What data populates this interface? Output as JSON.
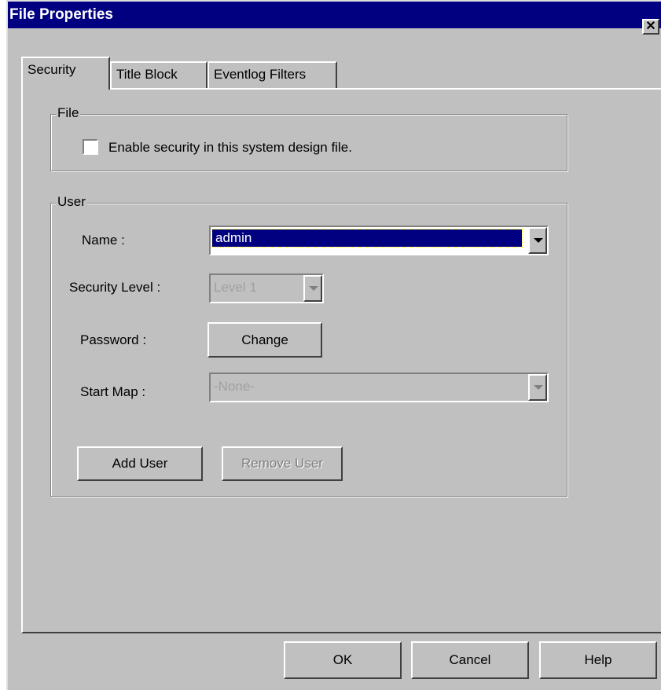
{
  "window": {
    "title": "File Properties",
    "close_glyph": "✕"
  },
  "tabs": [
    {
      "label": "Security",
      "active": true
    },
    {
      "label": "Title Block",
      "active": false
    },
    {
      "label": "Eventlog Filters",
      "active": false
    }
  ],
  "file_group": {
    "legend": "File",
    "enable_security_label": "Enable security in this system design file.",
    "enable_security_checked": false
  },
  "user_group": {
    "legend": "User",
    "name_label": "Name :",
    "name_value": "admin",
    "security_level_label": "Security Level :",
    "security_level_value": "Level 1",
    "password_label": "Password :",
    "change_button": "Change",
    "start_map_label": "Start Map :",
    "start_map_value": "-None-",
    "add_user_button": "Add User",
    "remove_user_button": "Remove User"
  },
  "footer": {
    "ok_button": "OK",
    "cancel_button": "Cancel",
    "help_button": "Help"
  },
  "colors": {
    "titlebar": "#000080",
    "face": "#c0c0c0",
    "selection": "#000080"
  }
}
